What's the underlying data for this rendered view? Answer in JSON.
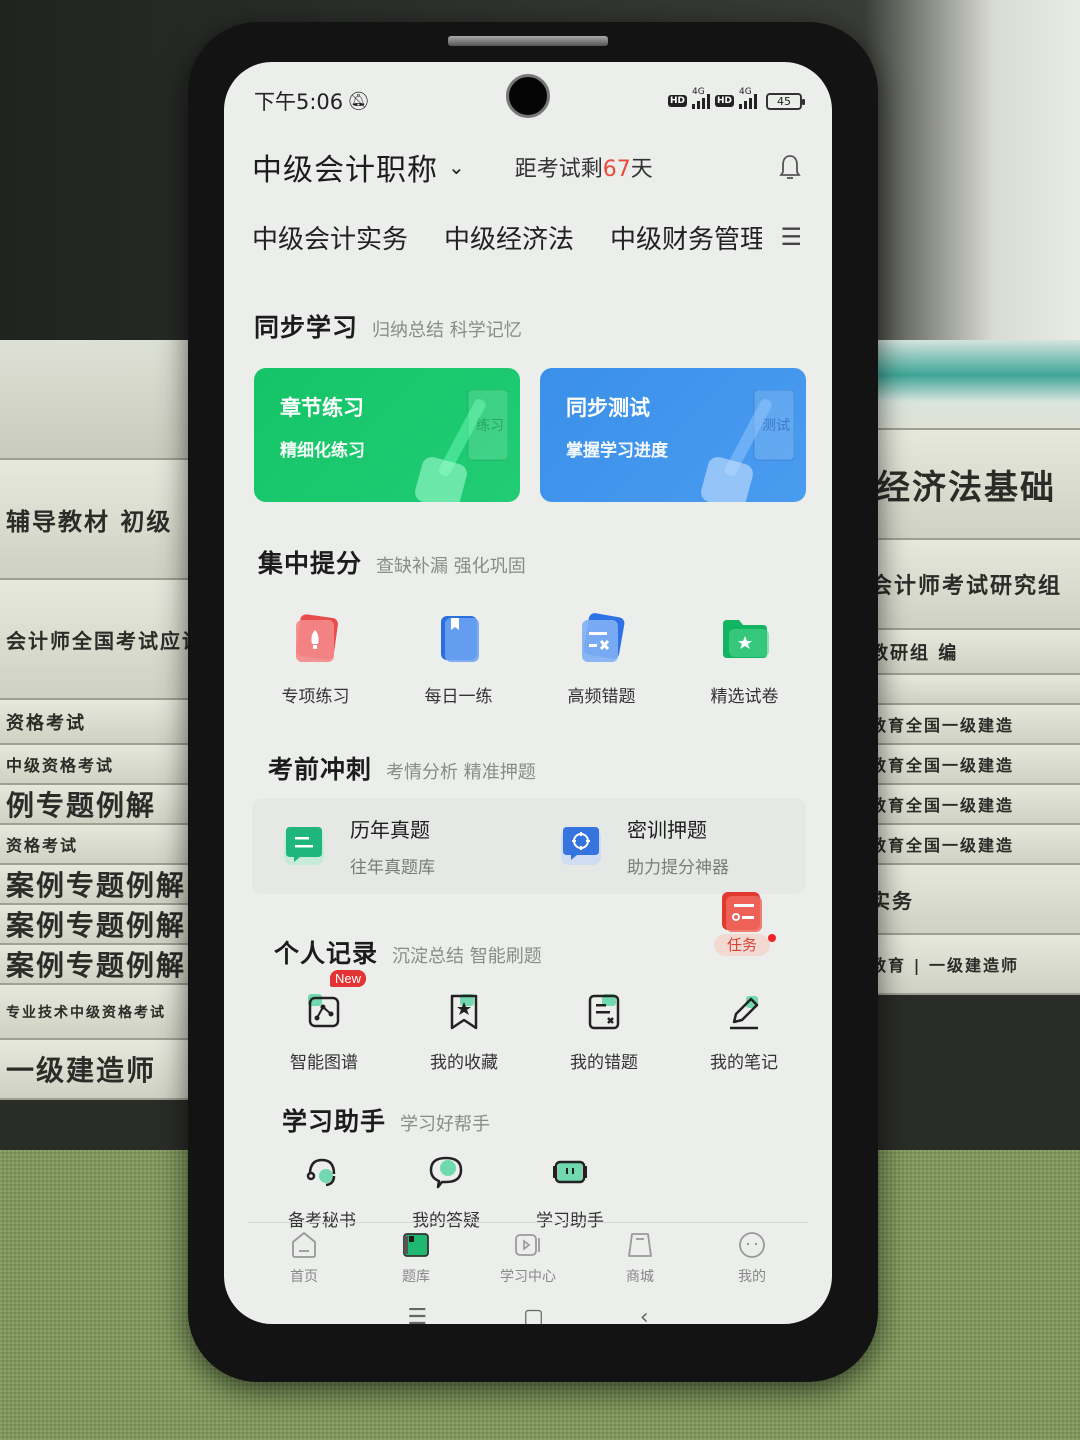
{
  "status_bar": {
    "time": "下午5:06",
    "network_1": "4G",
    "network_2": "4G",
    "hd_label": "HD",
    "battery": "45"
  },
  "header": {
    "exam_title": "中级会计职称",
    "countdown_prefix": "距考试剩",
    "countdown_days": "67",
    "countdown_suffix": "天"
  },
  "subject_tabs": [
    {
      "label": "中级会计实务",
      "active": true
    },
    {
      "label": "中级经济法",
      "active": false
    },
    {
      "label": "中级财务管理",
      "active": false
    }
  ],
  "sections": {
    "sync_study": {
      "title": "同步学习",
      "subtitle": "归纳总结  科学记忆"
    },
    "focus_boost": {
      "title": "集中提分",
      "subtitle": "查缺补漏 强化巩固"
    },
    "pre_exam": {
      "title": "考前冲刺",
      "subtitle": "考情分析 精准押题"
    },
    "personal": {
      "title": "个人记录",
      "subtitle": "沉淀总结 智能刷题"
    },
    "assistant": {
      "title": "学习助手",
      "subtitle": "学习好帮手"
    }
  },
  "sync_cards": [
    {
      "title": "章节练习",
      "subtitle": "精细化练习",
      "deco_text": "练习",
      "color": "#1bc46c"
    },
    {
      "title": "同步测试",
      "subtitle": "掌握学习进度",
      "deco_text": "测试",
      "color": "#3d92ea"
    }
  ],
  "focus_items": [
    {
      "label": "专项练习",
      "icon": "rocket-icon",
      "color": "#ee5a5a"
    },
    {
      "label": "每日一练",
      "icon": "book-icon",
      "color": "#2f7be8"
    },
    {
      "label": "高频错题",
      "icon": "wrong-questions-icon",
      "color": "#3b82e6"
    },
    {
      "label": "精选试卷",
      "icon": "star-folder-icon",
      "color": "#15b865"
    }
  ],
  "pre_exam_items": [
    {
      "title": "历年真题",
      "subtitle": "往年真题库",
      "icon": "chat-list-icon",
      "color": "#1eb67a"
    },
    {
      "title": "密训押题",
      "subtitle": "助力提分神器",
      "icon": "target-icon",
      "color": "#3675e0"
    }
  ],
  "task": {
    "label": "任务"
  },
  "personal_items": [
    {
      "label": "智能图谱",
      "icon": "graph-icon",
      "badge": "New"
    },
    {
      "label": "我的收藏",
      "icon": "bookmark-star-icon"
    },
    {
      "label": "我的错题",
      "icon": "wrong-note-icon"
    },
    {
      "label": "我的笔记",
      "icon": "pencil-icon"
    }
  ],
  "assistant_items": [
    {
      "label": "备考秘书",
      "icon": "headset-icon"
    },
    {
      "label": "我的答疑",
      "icon": "speech-bubble-icon"
    },
    {
      "label": "学习助手",
      "icon": "robot-icon"
    }
  ],
  "bottom_nav": [
    {
      "label": "首页",
      "icon": "home-icon",
      "active": false
    },
    {
      "label": "题库",
      "icon": "question-bank-icon",
      "active": true
    },
    {
      "label": "学习中心",
      "icon": "video-icon",
      "active": false
    },
    {
      "label": "商城",
      "icon": "shop-bag-icon",
      "active": false
    },
    {
      "label": "我的",
      "icon": "profile-face-icon",
      "active": false
    }
  ],
  "accent_colors": {
    "primary_green": "#1ea672",
    "countdown_red": "#ee4a3b",
    "badge_red": "#e33334"
  },
  "background_books": {
    "left": [
      "辅导教材  初级",
      "会计师全国考试应试指南",
      "资格考试",
      "中级资格考试",
      "例专题例解",
      "资格考试",
      "案例专题例解",
      "案例专题例解",
      "案例专题例解",
      "专业技术中级资格考试",
      "一级建造师"
    ],
    "right": [
      "经济法基础",
      "会计师考试研究组",
      "教研组  编",
      "",
      "教育全国一级建造",
      "教育全国一级建造",
      "教育全国一级建造",
      "教育全国一级建造",
      "实务",
      "教育 | 一级建造师"
    ]
  }
}
